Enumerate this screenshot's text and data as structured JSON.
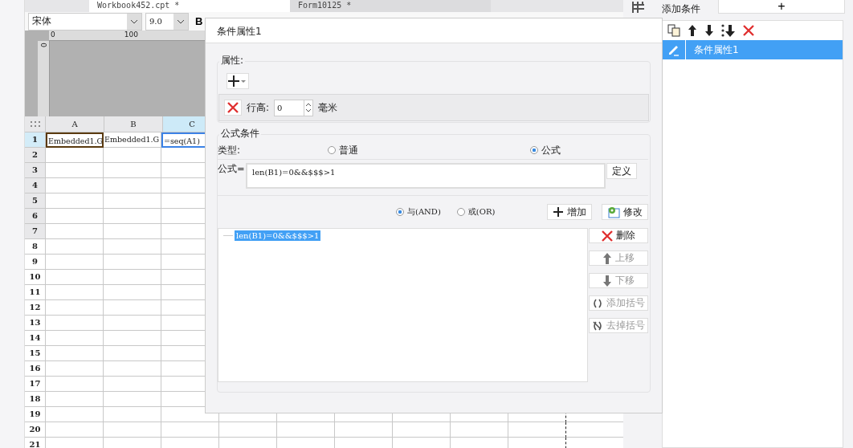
{
  "tabs": [
    {
      "label": "Workbook452.cpt *",
      "selected": true
    },
    {
      "label": "Form10125 *",
      "selected": false
    }
  ],
  "toolbar": {
    "font": "宋体",
    "size": "9.0",
    "bold": "B"
  },
  "ruler": {
    "marks": [
      "0",
      "100"
    ],
    "vertical": "0"
  },
  "sheet": {
    "columns": [
      {
        "label": "A",
        "selected": false
      },
      {
        "label": "B",
        "selected": false
      },
      {
        "label": "C",
        "selected": true
      }
    ],
    "rows": [
      {
        "label": "1",
        "selected": true,
        "shaded": false,
        "cells": [
          "Embedded1.G",
          "Embedded1.G",
          "=seq(A1)"
        ]
      },
      {
        "label": "2",
        "selected": false,
        "shaded": true,
        "cells": []
      },
      {
        "label": "3",
        "selected": false,
        "shaded": true,
        "cells": []
      },
      {
        "label": "4",
        "selected": false,
        "shaded": true,
        "cells": []
      },
      {
        "label": "5",
        "selected": false,
        "shaded": true,
        "cells": []
      },
      {
        "label": "6",
        "selected": false,
        "shaded": true,
        "cells": []
      },
      {
        "label": "7",
        "selected": false,
        "shaded": true,
        "cells": []
      },
      {
        "label": "8",
        "selected": false,
        "shaded": false,
        "cells": []
      },
      {
        "label": "9",
        "selected": false,
        "shaded": false,
        "cells": []
      },
      {
        "label": "10",
        "selected": false,
        "shaded": false,
        "cells": []
      },
      {
        "label": "11",
        "selected": false,
        "shaded": false,
        "cells": []
      },
      {
        "label": "12",
        "selected": false,
        "shaded": false,
        "cells": []
      },
      {
        "label": "13",
        "selected": false,
        "shaded": false,
        "cells": []
      },
      {
        "label": "14",
        "selected": false,
        "shaded": false,
        "cells": []
      },
      {
        "label": "15",
        "selected": false,
        "shaded": false,
        "cells": []
      },
      {
        "label": "16",
        "selected": false,
        "shaded": false,
        "cells": []
      },
      {
        "label": "17",
        "selected": false,
        "shaded": false,
        "cells": []
      },
      {
        "label": "18",
        "selected": false,
        "shaded": false,
        "cells": []
      },
      {
        "label": "19",
        "selected": false,
        "shaded": false,
        "cells": []
      },
      {
        "label": "20",
        "selected": false,
        "shaded": false,
        "cells": []
      },
      {
        "label": "21",
        "selected": false,
        "shaded": false,
        "cells": []
      }
    ]
  },
  "dialog": {
    "title": "条件属性1",
    "properties": {
      "legend": "属性:",
      "row_height_label": "行高:",
      "value": "0",
      "unit": "毫米"
    },
    "formula_condition": {
      "legend": "公式条件",
      "type_label": "类型:",
      "types": [
        {
          "label": "普通",
          "selected": false
        },
        {
          "label": "公式",
          "selected": true
        }
      ],
      "formula_label": "公式=",
      "formula": "len(B1)=0&&$$$>1",
      "define_button": "定义",
      "logic": [
        {
          "label": "与(AND)",
          "selected": true
        },
        {
          "label": "或(OR)",
          "selected": false
        }
      ],
      "add_button": "增加",
      "modify_button": "修改",
      "conditions": [
        {
          "text": "len(B1)=0&&$$$>1",
          "selected": true
        }
      ],
      "side_buttons": [
        {
          "kind": "delete",
          "label": "删除",
          "disabled": false
        },
        {
          "kind": "up",
          "label": "上移",
          "disabled": true
        },
        {
          "kind": "down",
          "label": "下移",
          "disabled": true
        },
        {
          "kind": "add-paren",
          "label": "添加括号",
          "disabled": true
        },
        {
          "kind": "remove-paren",
          "label": "去掉括号",
          "disabled": true
        }
      ]
    }
  },
  "right_panel": {
    "title": "添加条件",
    "add_button": "+",
    "items": [
      {
        "label": "条件属性1",
        "selected": true
      }
    ]
  }
}
